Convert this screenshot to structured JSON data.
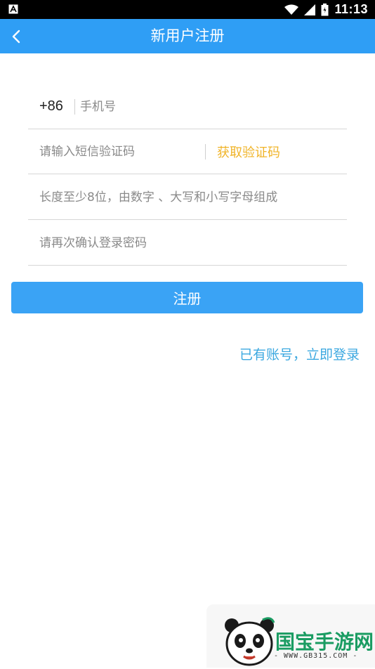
{
  "status_bar": {
    "time": "11:13",
    "icons": [
      "app-notification-icon",
      "wifi-icon",
      "cell-signal-icon",
      "battery-icon"
    ]
  },
  "app_bar": {
    "title": "新用户注册",
    "back_icon": "chevron-left-icon"
  },
  "form": {
    "phone": {
      "country_code": "+86",
      "placeholder": "手机号",
      "value": ""
    },
    "sms_code": {
      "placeholder": "请输入短信验证码",
      "value": "",
      "get_code_label": "获取验证码"
    },
    "password": {
      "placeholder": "长度至少8位，由数字 、大写和小写字母组成",
      "value": ""
    },
    "confirm_password": {
      "placeholder": "请再次确认登录密码",
      "value": ""
    },
    "submit_label": "注册",
    "login_link": "已有账号，立即登录"
  },
  "watermark": {
    "brand": "国宝手游网",
    "url": "- WWW.GB315.COM -"
  },
  "colors": {
    "primary": "#2f9ef5",
    "button": "#3aa3f5",
    "get_code": "#f0b429",
    "link": "#3ba8e0",
    "watermark_green": "#1a9c62"
  }
}
